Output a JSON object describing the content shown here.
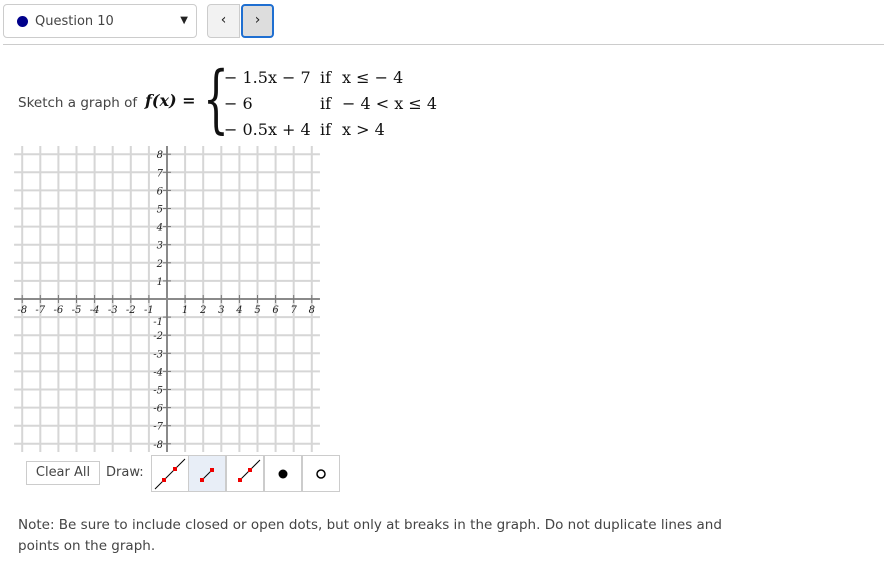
{
  "header": {
    "question_label": "Question 10",
    "question_status_color": "#00008b",
    "prev_icon": "‹",
    "next_icon": "›",
    "dropdown_caret": "▼"
  },
  "question": {
    "prompt": "Sketch a graph of",
    "function_lhs": "f(x) =",
    "cases": [
      {
        "expr": "− 1.5x − 7",
        "if": "if",
        "cond": "x ≤ − 4"
      },
      {
        "expr": "− 6",
        "if": "if",
        "cond": "− 4 < x ≤ 4"
      },
      {
        "expr": "− 0.5x + 4",
        "if": "if",
        "cond": "x > 4"
      }
    ]
  },
  "graph": {
    "x_range": [
      -8,
      8
    ],
    "y_range": [
      -8,
      8
    ],
    "x_ticks": [
      "-8",
      "-7",
      "-6",
      "-5",
      "-4",
      "-3",
      "-2",
      "-1",
      "1",
      "2",
      "3",
      "4",
      "5",
      "6",
      "7",
      "8"
    ],
    "y_ticks": [
      "8",
      "7",
      "6",
      "5",
      "4",
      "3",
      "2",
      "1",
      "-1",
      "-2",
      "-3",
      "-4",
      "-5",
      "-6",
      "-7",
      "-8"
    ]
  },
  "toolbar": {
    "clear_label": "Clear All",
    "draw_label": "Draw:",
    "tools": [
      {
        "name": "line-tool",
        "selected": false
      },
      {
        "name": "segment-tool",
        "selected": true
      },
      {
        "name": "ray-tool",
        "selected": false
      },
      {
        "name": "closed-dot-tool",
        "selected": false
      },
      {
        "name": "open-dot-tool",
        "selected": false
      }
    ]
  },
  "note": "Note: Be sure to include closed or open dots, but only at breaks in the graph. Do not duplicate lines and points on the graph."
}
